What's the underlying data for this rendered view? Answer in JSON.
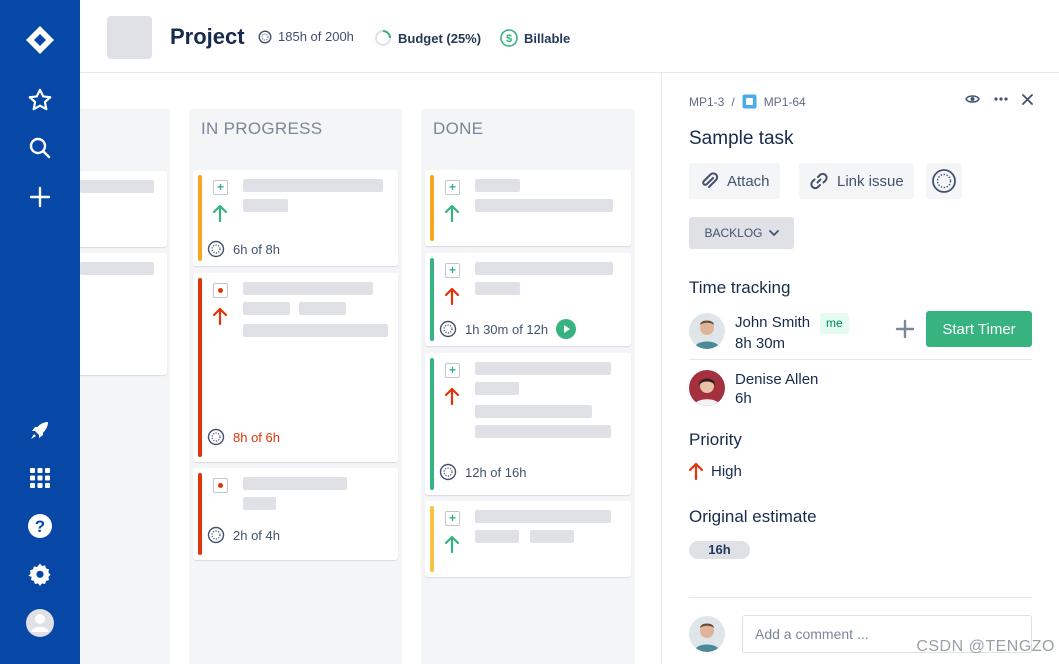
{
  "header": {
    "project_title": "Project",
    "time_stat": "185h of 200h",
    "budget_stat": "Budget (25%)",
    "billable_stat": "Billable"
  },
  "board": {
    "columns": [
      {
        "title": "IN PROGRESS"
      },
      {
        "title": "DONE"
      }
    ],
    "in_progress_cards": [
      {
        "estimate": "6h of 8h",
        "over": false
      },
      {
        "estimate": "8h of 6h",
        "over": true
      },
      {
        "estimate": "2h of 4h",
        "over": false
      }
    ],
    "done_cards": [
      {
        "estimate": ""
      },
      {
        "estimate": "1h 30m of 12h"
      },
      {
        "estimate": "12h of 16h"
      },
      {
        "estimate": ""
      }
    ]
  },
  "panel": {
    "breadcrumb_parent": "MP1-3",
    "breadcrumb_sep": "/",
    "breadcrumb_issue": "MP1-64",
    "task_title": "Sample task",
    "attach_label": "Attach",
    "link_issue_label": "Link issue",
    "status_label": "BACKLOG",
    "time_tracking_heading": "Time tracking",
    "users": [
      {
        "name": "John Smith",
        "time": "8h 30m",
        "tag": "me"
      },
      {
        "name": "Denise Allen",
        "time": "6h"
      }
    ],
    "start_timer_label": "Start Timer",
    "priority_heading": "Priority",
    "priority_value": "High",
    "original_estimate_heading": "Original estimate",
    "original_estimate_value": "16h",
    "comment_placeholder": "Add a comment ..."
  },
  "watermark": "CSDN @TENGZO",
  "colors": {
    "nav": "#0747a6",
    "orange": "#f6a623",
    "red": "#de350b",
    "green": "#36b37e",
    "yellow": "#f6c342"
  }
}
